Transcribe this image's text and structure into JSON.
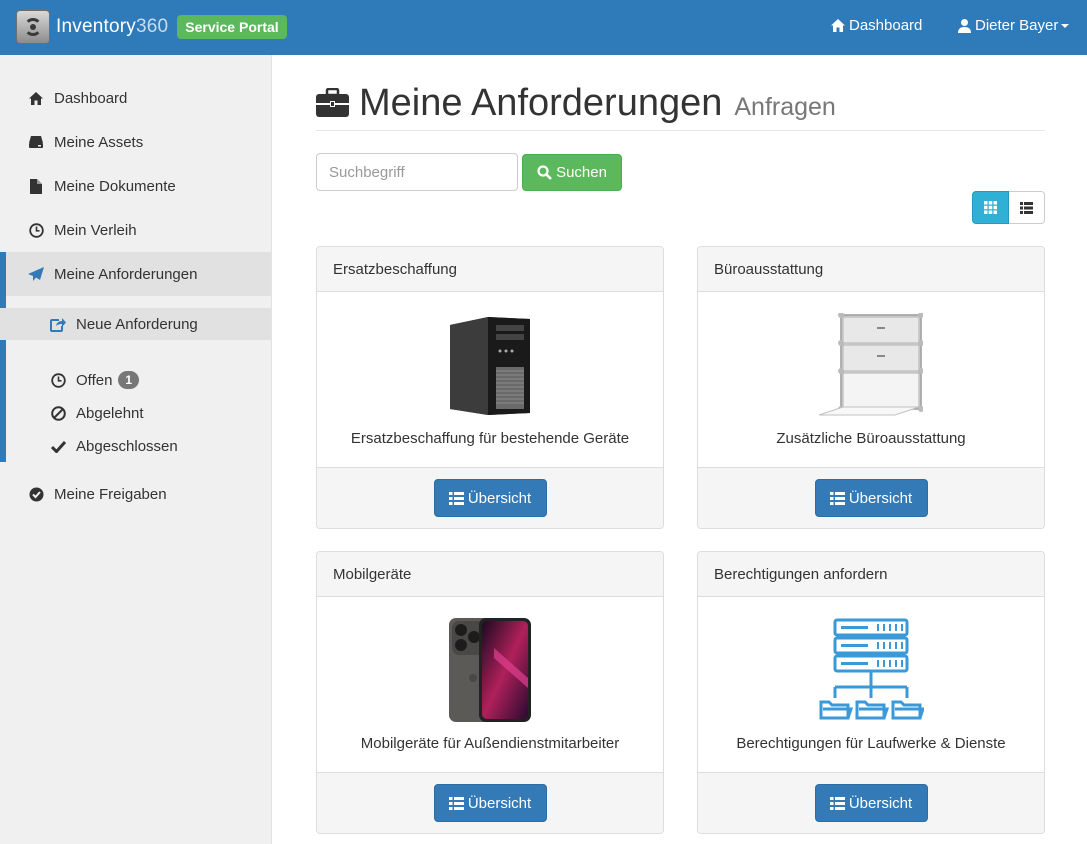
{
  "navbar": {
    "brand_name": "Inventory",
    "brand_number": "360",
    "portal_badge": "Service Portal",
    "dashboard_link": "Dashboard",
    "user_name": "Dieter Bayer"
  },
  "sidebar": {
    "items": [
      {
        "label": "Dashboard",
        "icon": "home-icon"
      },
      {
        "label": "Meine Assets",
        "icon": "hdd-icon"
      },
      {
        "label": "Meine Dokumente",
        "icon": "file-icon"
      },
      {
        "label": "Mein Verleih",
        "icon": "clock-icon"
      },
      {
        "label": "Meine Anforderungen",
        "icon": "send-icon"
      },
      {
        "label": "Meine Freigaben",
        "icon": "check-circle-icon"
      }
    ],
    "sub_items": [
      {
        "label": "Neue Anforderung",
        "icon": "share-icon"
      },
      {
        "label": "Offen",
        "icon": "clock-icon",
        "count": "1"
      },
      {
        "label": "Abgelehnt",
        "icon": "ban-icon"
      },
      {
        "label": "Abgeschlossen",
        "icon": "check-icon"
      }
    ]
  },
  "main": {
    "title": "Meine Anforderungen",
    "subtitle": "Anfragen",
    "search_placeholder": "Suchbegriff",
    "search_button": "Suchen",
    "cards": [
      {
        "heading": "Ersatzbeschaffung",
        "description": "Ersatzbeschaffung für bestehende Geräte",
        "button": "Übersicht",
        "image": "pc-tower-image"
      },
      {
        "heading": "Büroausstattung",
        "description": "Zusätzliche Büroausstattung",
        "button": "Übersicht",
        "image": "office-cabinet-image"
      },
      {
        "heading": "Mobilgeräte",
        "description": "Mobilgeräte für Außendienstmitarbeiter",
        "button": "Übersicht",
        "image": "smartphone-image"
      },
      {
        "heading": "Berechtigungen anfordern",
        "description": "Berechtigungen für Laufwerke & Dienste",
        "button": "Übersicht",
        "image": "server-folders-image"
      }
    ]
  },
  "colors": {
    "navbar": "#2f7bba",
    "badge": "#5cb85c",
    "primary_button": "#337ab7",
    "toggle_active": "#31b0d5"
  }
}
